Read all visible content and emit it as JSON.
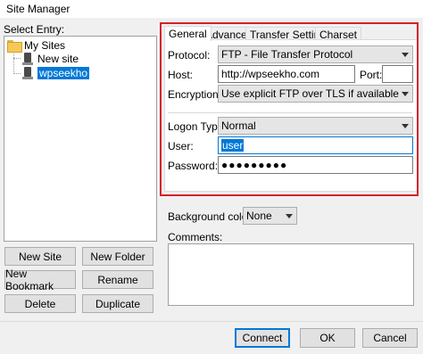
{
  "window": {
    "title": "Site Manager"
  },
  "tree": {
    "label": "Select Entry:",
    "root": "My Sites",
    "items": [
      "New site",
      "wpseekho"
    ],
    "selected": "wpseekho"
  },
  "left_buttons": {
    "new_site": "New Site",
    "new_folder": "New Folder",
    "new_bookmark": "New Bookmark",
    "rename": "Rename",
    "delete": "Delete",
    "duplicate": "Duplicate"
  },
  "tabs": [
    "General",
    "Advanced",
    "Transfer Settings",
    "Charset"
  ],
  "active_tab": "General",
  "general": {
    "protocol_label": "Protocol:",
    "protocol_value": "FTP - File Transfer Protocol",
    "host_label": "Host:",
    "host_value": "http://wpseekho.com",
    "port_label": "Port:",
    "port_value": "",
    "encryption_label": "Encryption:",
    "encryption_value": "Use explicit FTP over TLS if available",
    "logon_label": "Logon Type:",
    "logon_value": "Normal",
    "user_label": "User:",
    "user_value": "user",
    "password_label": "Password:",
    "password_value": "●●●●●●●●●"
  },
  "background": {
    "label": "Background color:",
    "value": "None"
  },
  "comments": {
    "label": "Comments:",
    "value": ""
  },
  "bottom_buttons": {
    "connect": "Connect",
    "ok": "OK",
    "cancel": "Cancel"
  },
  "colors": {
    "highlight_border": "#d61f2c",
    "selection": "#0078d7"
  }
}
